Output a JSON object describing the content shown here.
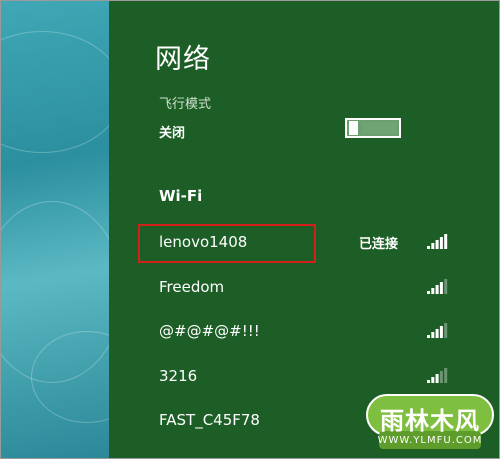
{
  "pane": {
    "title": "网络",
    "airplane_mode": {
      "label": "飞行模式",
      "state_label": "关闭",
      "enabled": false
    },
    "wifi_heading": "Wi-Fi",
    "networks": [
      {
        "name": "lenovo1408",
        "status": "已连接",
        "signal_bars": 5,
        "highlighted": true
      },
      {
        "name": "Freedom",
        "status": "",
        "signal_bars": 4
      },
      {
        "name": "@#@#@#!!!",
        "status": "",
        "signal_bars": 4
      },
      {
        "name": "3216",
        "status": "",
        "signal_bars": 3
      },
      {
        "name": "FAST_C45F78",
        "status": "",
        "signal_bars": 4
      }
    ]
  },
  "watermark": {
    "text": "雨林木风",
    "url": "WWW.YLMFU.COM"
  },
  "colors": {
    "pane_background": "#1c5e26",
    "highlight_border": "#d4201c",
    "desktop_teal": "#3fa7b5"
  }
}
